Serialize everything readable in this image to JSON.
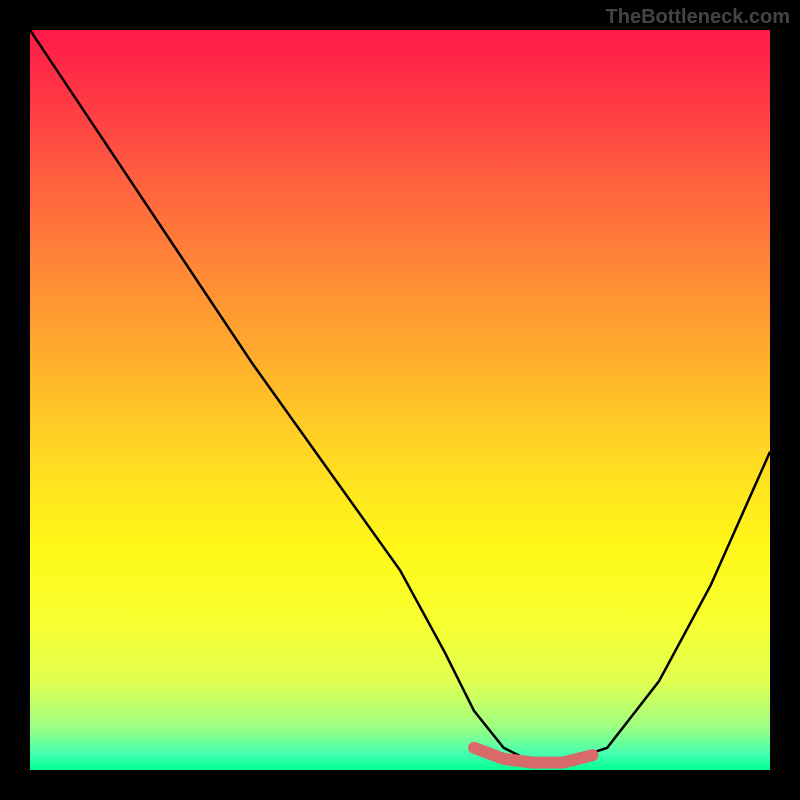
{
  "watermark": "TheBottleneck.com",
  "chart_data": {
    "type": "line",
    "title": "",
    "xlabel": "",
    "ylabel": "",
    "xlim": [
      0,
      100
    ],
    "ylim": [
      0,
      100
    ],
    "series": [
      {
        "name": "bottleneck-curve",
        "x": [
          0,
          10,
          20,
          30,
          40,
          50,
          56,
          60,
          64,
          68,
          72,
          78,
          85,
          92,
          100
        ],
        "values": [
          100,
          85,
          70,
          55,
          41,
          27,
          16,
          8,
          3,
          1,
          1,
          3,
          12,
          25,
          43
        ],
        "color": "#000000"
      },
      {
        "name": "highlight-segment",
        "x": [
          60,
          64,
          68,
          72,
          76
        ],
        "values": [
          3.0,
          1.5,
          1.0,
          1.0,
          2.0
        ],
        "color": "#d86a6a"
      }
    ],
    "gradient_colors": {
      "top": "#ff1a48",
      "mid_upper": "#ff8038",
      "mid": "#ffe020",
      "mid_lower": "#e0ff50",
      "bottom": "#00ff90"
    }
  }
}
